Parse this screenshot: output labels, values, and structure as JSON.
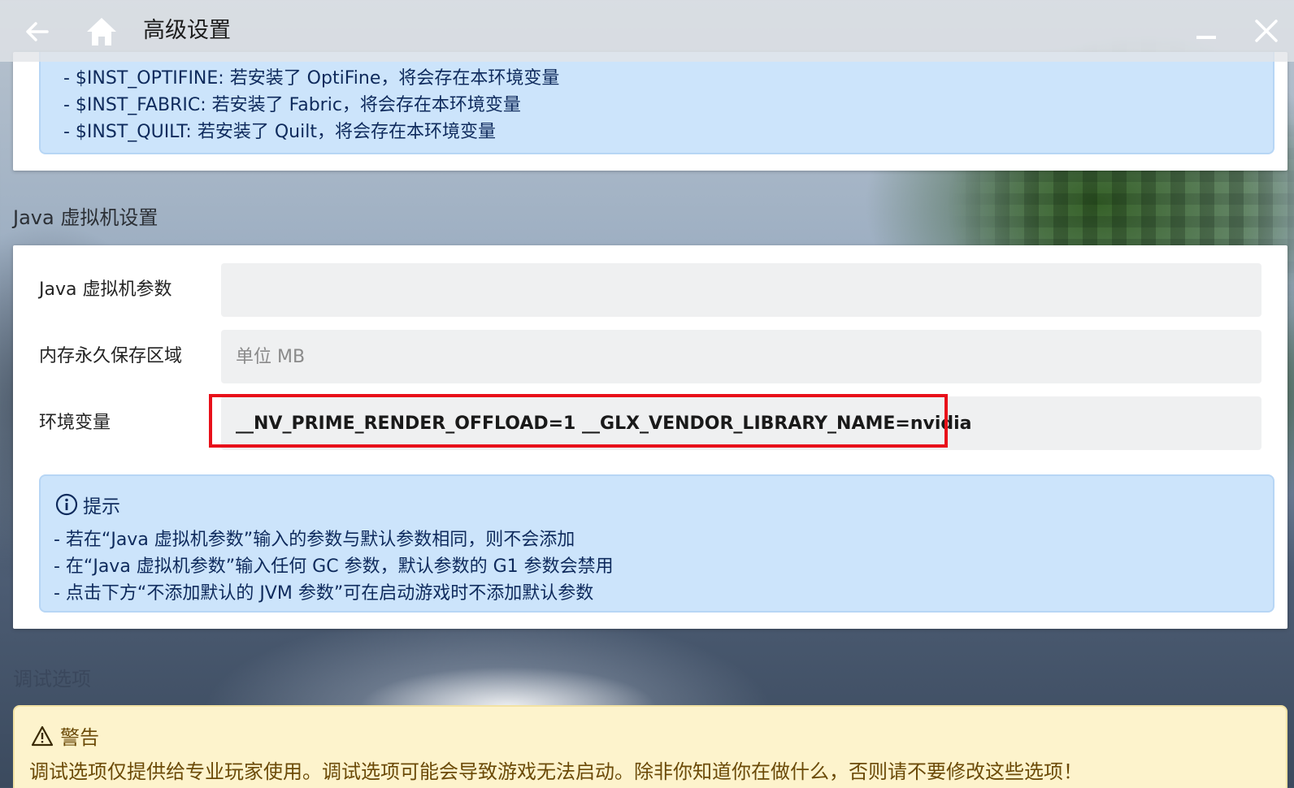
{
  "titlebar": {
    "title": "高级设置",
    "back_icon": "arrow-left-icon",
    "home_icon": "home-icon",
    "minimize_icon": "minimize-icon",
    "close_icon": "close-icon"
  },
  "top_info": {
    "lines": [
      "- $INST_OPTIFINE: 若安装了 OptiFine，将会存在本环境变量",
      "- $INST_FABRIC: 若安装了 Fabric，将会存在本环境变量",
      "- $INST_QUILT: 若安装了 Quilt，将会存在本环境变量"
    ]
  },
  "jvm_section": {
    "title": "Java 虚拟机设置",
    "jvm_args": {
      "label": "Java 虚拟机参数",
      "value": "",
      "placeholder": ""
    },
    "permgen": {
      "label": "内存永久保存区域",
      "value": "",
      "placeholder": "单位 MB"
    },
    "env_vars": {
      "label": "环境变量",
      "value": "__NV_PRIME_RENDER_OFFLOAD=1 __GLX_VENDOR_LIBRARY_NAME=nvidia"
    },
    "hint": {
      "title": "提示",
      "icon": "info-icon",
      "lines": [
        "- 若在“Java 虚拟机参数”输入的参数与默认参数相同，则不会添加",
        "- 在“Java 虚拟机参数”输入任何 GC 参数，默认参数的 G1 参数会禁用",
        "- 点击下方“不添加默认的 JVM 参数”可在启动游戏时不添加默认参数"
      ]
    }
  },
  "debug_section": {
    "title": "调试选项",
    "warning": {
      "title": "警告",
      "icon": "warning-icon",
      "text": "调试选项仅提供给专业玩家使用。调试选项可能会导致游戏无法启动。除非你知道你在做什么，否则请不要修改这些选项！"
    }
  },
  "colors": {
    "info_bg": "#cce4fb",
    "info_text": "#0e2a5c",
    "warn_bg": "#fdf3cc",
    "warn_text": "#6b4a07",
    "highlight": "#e8101a"
  }
}
